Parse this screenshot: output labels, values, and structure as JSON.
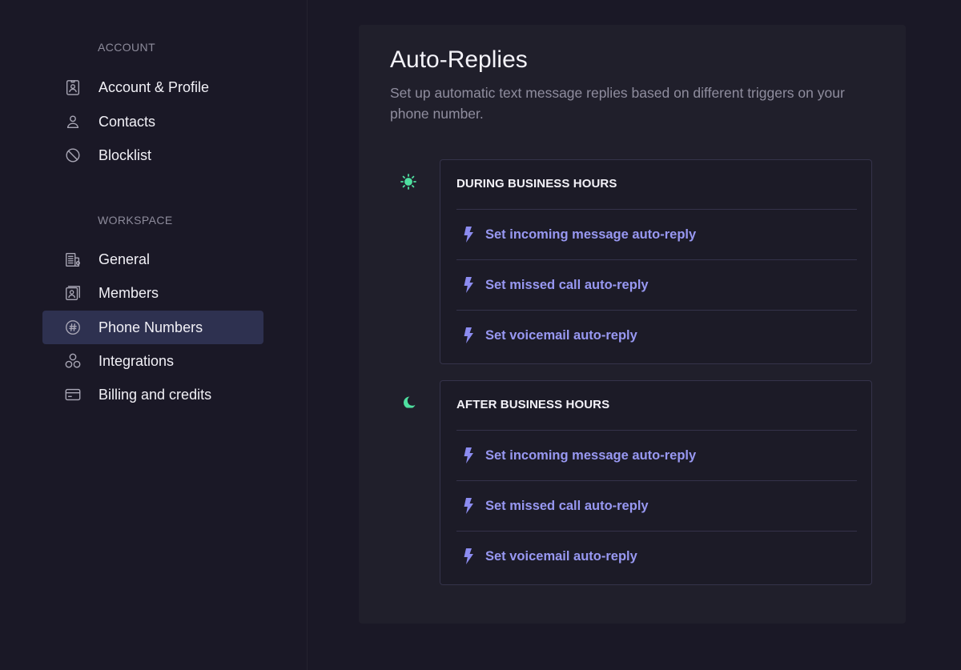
{
  "sidebar": {
    "sections": [
      {
        "label": "ACCOUNT",
        "items": [
          {
            "label": "Account & Profile",
            "icon": "id-badge-icon",
            "active": false
          },
          {
            "label": "Contacts",
            "icon": "person-icon",
            "active": false
          },
          {
            "label": "Blocklist",
            "icon": "block-icon",
            "active": false
          }
        ]
      },
      {
        "label": "WORKSPACE",
        "items": [
          {
            "label": "General",
            "icon": "building-icon",
            "active": false
          },
          {
            "label": "Members",
            "icon": "members-icon",
            "active": false
          },
          {
            "label": "Phone Numbers",
            "icon": "hash-icon",
            "active": true
          },
          {
            "label": "Integrations",
            "icon": "integrations-icon",
            "active": false
          },
          {
            "label": "Billing and credits",
            "icon": "credit-card-icon",
            "active": false
          }
        ]
      }
    ]
  },
  "main": {
    "title": "Auto-Replies",
    "subtitle": "Set up automatic text message replies based on different triggers on your phone number.",
    "groups": [
      {
        "header": "DURING BUSINESS HOURS",
        "icon": "sun-icon",
        "rows": [
          {
            "label": "Set incoming message auto-reply",
            "icon": "lightning-icon"
          },
          {
            "label": "Set missed call auto-reply",
            "icon": "lightning-icon"
          },
          {
            "label": "Set voicemail auto-reply",
            "icon": "lightning-icon"
          }
        ]
      },
      {
        "header": "AFTER BUSINESS HOURS",
        "icon": "moon-icon",
        "rows": [
          {
            "label": "Set incoming message auto-reply",
            "icon": "lightning-icon"
          },
          {
            "label": "Set missed call auto-reply",
            "icon": "lightning-icon"
          },
          {
            "label": "Set voicemail auto-reply",
            "icon": "lightning-icon"
          }
        ]
      }
    ]
  },
  "colors": {
    "background": "#1a1826",
    "panel": "#201f2b",
    "active_item": "#2e3150",
    "accent_link": "#9898f2",
    "group_icon": "#4fe0a0"
  }
}
